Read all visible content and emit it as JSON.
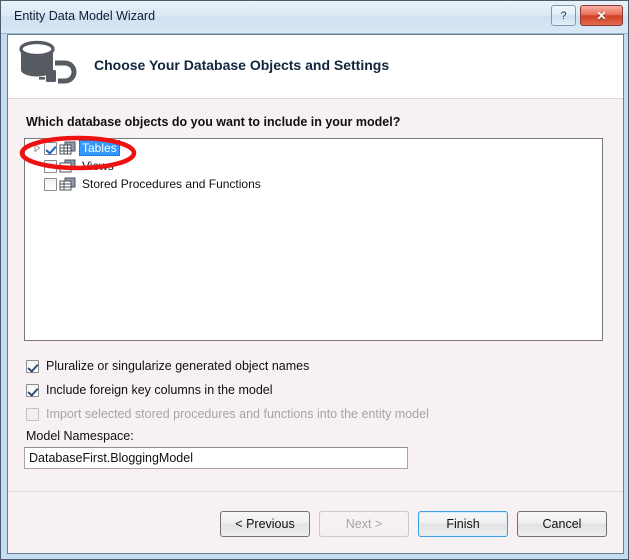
{
  "window": {
    "title": "Entity Data Model Wizard",
    "help_button_label": "?",
    "close_button_label": "✕"
  },
  "header": {
    "icon": "database-connection-icon",
    "title": "Choose Your Database Objects and Settings"
  },
  "main": {
    "prompt": "Which database objects do you want to include in your model?",
    "tree": {
      "nodes": [
        {
          "label": "Tables",
          "checked": true,
          "selected": true,
          "expandable": true,
          "icon": "table-icon"
        },
        {
          "label": "Views",
          "checked": false,
          "selected": false,
          "expandable": false,
          "icon": "view-icon"
        },
        {
          "label": "Stored Procedures and Functions",
          "checked": false,
          "selected": false,
          "expandable": false,
          "icon": "procedure-icon"
        }
      ]
    },
    "options": [
      {
        "label": "Pluralize or singularize generated object names",
        "checked": true,
        "disabled": false
      },
      {
        "label": "Include foreign key columns in the model",
        "checked": true,
        "disabled": false
      },
      {
        "label": "Import selected stored procedures and functions into the entity model",
        "checked": false,
        "disabled": true
      }
    ],
    "namespace": {
      "label": "Model Namespace:",
      "value": "DatabaseFirst.BloggingModel",
      "placeholder": ""
    }
  },
  "footer": {
    "buttons": [
      {
        "label": "< Previous",
        "disabled": false,
        "default": false
      },
      {
        "label": "Next >",
        "disabled": true,
        "default": false
      },
      {
        "label": "Finish",
        "disabled": false,
        "default": true
      },
      {
        "label": "Cancel",
        "disabled": false,
        "default": false
      }
    ]
  },
  "annotation": {
    "shape": "ellipse",
    "color": "#ee1111",
    "target": "Tables"
  }
}
